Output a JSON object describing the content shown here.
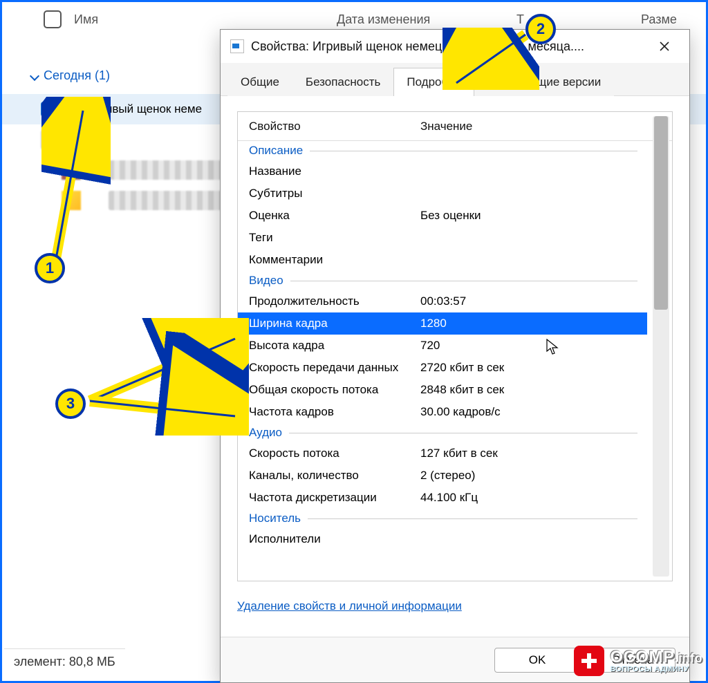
{
  "explorer": {
    "columns": {
      "name": "Имя",
      "date": "Дата изменения",
      "type": "Т",
      "size": "Разме"
    },
    "group": {
      "label": "Сегодня",
      "count_suffix": "(1)"
    },
    "file": {
      "name": "Игривый щенок неме"
    },
    "status": "элемент: 80,8 МБ"
  },
  "dialog": {
    "title": "Свойства: Игривый щенок немецкой     вчарки 1.5 месяца....",
    "tabs": {
      "general": "Общие",
      "security": "Безопасность",
      "details": "Подробно",
      "previous": "Предыдущие версии"
    },
    "grid_head": {
      "prop": "Свойство",
      "value": "Значение"
    },
    "sections": {
      "description": "Описание",
      "video": "Видео",
      "audio": "Аудио",
      "origin": "Носитель"
    },
    "desc": {
      "title": {
        "n": "Название",
        "v": ""
      },
      "subtitles": {
        "n": "Субтитры",
        "v": ""
      },
      "rating": {
        "n": "Оценка",
        "v": "Без оценки"
      },
      "tags": {
        "n": "Теги",
        "v": ""
      },
      "comments": {
        "n": "Комментарии",
        "v": ""
      }
    },
    "video": {
      "duration": {
        "n": "Продолжительность",
        "v": "00:03:57"
      },
      "frame_width": {
        "n": "Ширина кадра",
        "v": "1280"
      },
      "frame_height": {
        "n": "Высота кадра",
        "v": "720"
      },
      "data_rate": {
        "n": "Скорость передачи данных",
        "v": "2720 кбит в сек"
      },
      "total_bitrate": {
        "n": "Общая скорость потока",
        "v": "2848 кбит в сек"
      },
      "frame_rate": {
        "n": "Частота кадров",
        "v": "30.00 кадров/с"
      }
    },
    "audio": {
      "bitrate": {
        "n": "Скорость потока",
        "v": "127 кбит в сек"
      },
      "channels": {
        "n": "Каналы, количество",
        "v": "2 (стерео)"
      },
      "sample_rate": {
        "n": "Частота дискретизации",
        "v": "44.100 кГц"
      }
    },
    "origin": {
      "performers": {
        "n": "Исполнители",
        "v": ""
      }
    },
    "remove_link": "Удаление свойств и личной информации",
    "ok": "OK",
    "cancel": "Отмена"
  },
  "annotations": {
    "badge1": "1",
    "badge2": "2",
    "badge3": "3"
  },
  "watermark": {
    "brand": "OCOMP",
    "tld": ".info",
    "sub": "ВОПРОСЫ АДМИНУ"
  }
}
